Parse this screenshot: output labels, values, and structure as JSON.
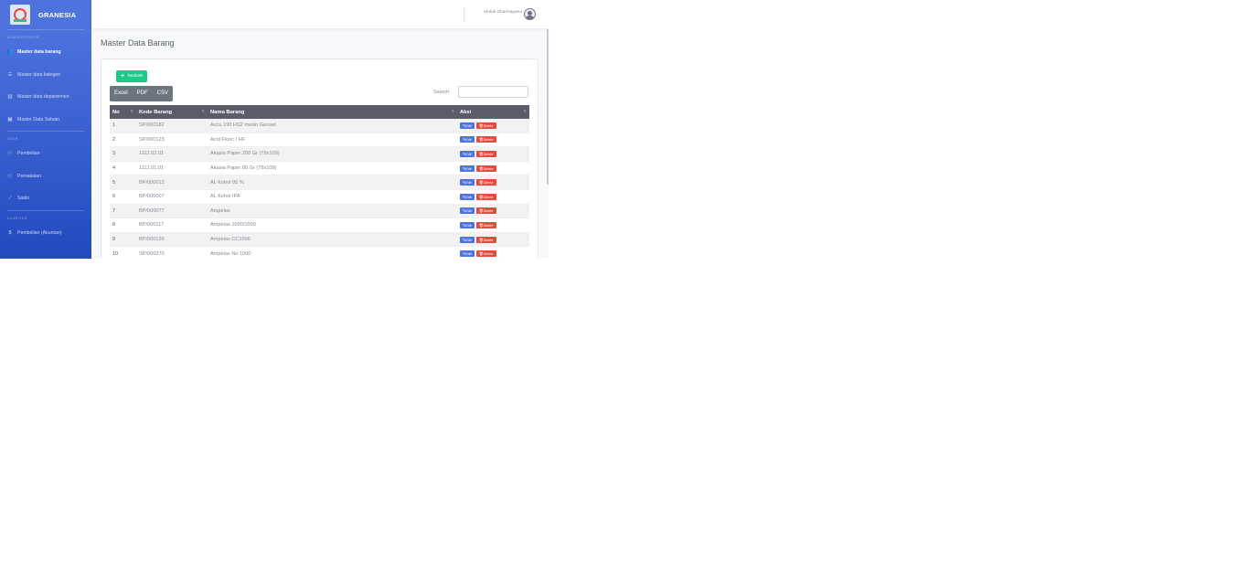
{
  "brand": {
    "name": "GRANESIA"
  },
  "sidebar": {
    "headings": [
      "ADMINISTRATOR",
      "USER",
      "AKUNTING"
    ],
    "admin_items": [
      {
        "label": "Master data barang",
        "icon": "users-icon",
        "glyph": "👥"
      },
      {
        "label": "Master data kategori",
        "icon": "list-icon",
        "glyph": "☰"
      },
      {
        "label": "Master data departemen",
        "icon": "building-icon",
        "glyph": "▥"
      },
      {
        "label": "Master Data Satuan",
        "icon": "table-icon",
        "glyph": "▦"
      }
    ],
    "user_items": [
      {
        "label": "Pembelian",
        "icon": "cart-icon",
        "glyph": "🛒"
      },
      {
        "label": "Pemakaian",
        "icon": "cart-out-icon",
        "glyph": "🛒"
      },
      {
        "label": "Saldo",
        "icon": "chart-icon",
        "glyph": "⟋"
      }
    ],
    "accounting_items": [
      {
        "label": "Pembelian (Akuntan)",
        "icon": "dollar-icon",
        "glyph": "$"
      }
    ]
  },
  "topbar": {
    "user_name": "Muluk Dharmayana"
  },
  "page": {
    "title": "Master Data Barang"
  },
  "toolbar": {
    "add_label": "Tambah",
    "export_buttons": [
      "Excel",
      "PDF",
      "CSV"
    ],
    "search_label": "Search:",
    "search_value": ""
  },
  "table": {
    "columns": [
      "No",
      "Kode Barang",
      "Nama Barang",
      "Aksi"
    ],
    "edit_label": "Edit",
    "delete_label": "Delete",
    "rows": [
      {
        "no": "1",
        "kode": "SP/000182",
        "nama": "Accu 190 HS2 mesin Genset"
      },
      {
        "no": "2",
        "kode": "SP/000123",
        "nama": "Acid Floric / HF"
      },
      {
        "no": "3",
        "kode": "1112.02.01",
        "nama": "Akasia Paper 200 Gr (79x109)"
      },
      {
        "no": "4",
        "kode": "1112.01.01",
        "nama": "Akasia Paper 80 Gr (79x109)"
      },
      {
        "no": "5",
        "kode": "BP/000012",
        "nama": "AL Kohol 95 %"
      },
      {
        "no": "6",
        "kode": "BP/000007",
        "nama": "AL Kohol IPA"
      },
      {
        "no": "7",
        "kode": "BP/000077",
        "nama": "Ampelas"
      },
      {
        "no": "8",
        "kode": "BP/000117",
        "nama": "Ampelas 1000/1500"
      },
      {
        "no": "9",
        "kode": "BP/000136",
        "nama": "Ampelas CC1000"
      },
      {
        "no": "10",
        "kode": "SP/000270",
        "nama": "Ampelas No 1000"
      }
    ]
  },
  "colors": {
    "sidebar": "#4e73df",
    "primary": "#4e73df",
    "success": "#1cc88a",
    "danger": "#e74a3b",
    "header": "#5a5c69"
  }
}
